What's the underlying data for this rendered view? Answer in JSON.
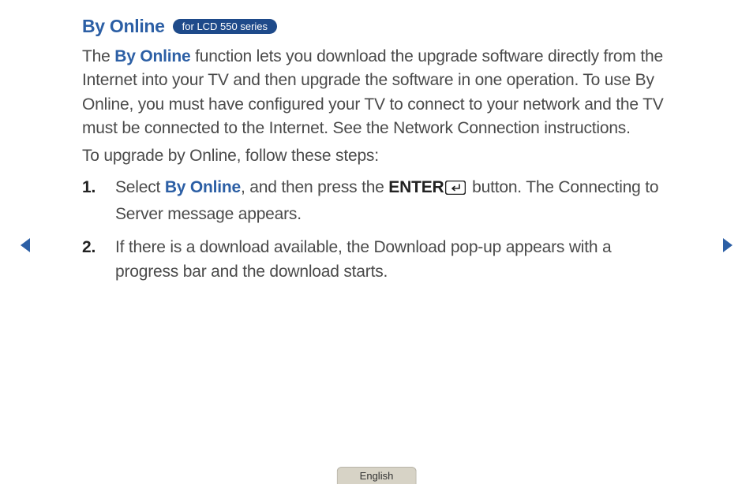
{
  "heading": {
    "title": "By Online",
    "badge": "for LCD 550 series"
  },
  "intro": {
    "part1": "The ",
    "highlight": "By Online",
    "part2": " function lets you download the upgrade software directly from the Internet into your TV and then upgrade the software in one operation. To use By Online, you must have configured your TV to connect to your network and the TV must be connected to the Internet. See the Network Connection instructions."
  },
  "followSteps": "To upgrade by Online, follow these steps:",
  "steps": [
    {
      "num": "1.",
      "pre": "Select ",
      "highlight": "By Online",
      "mid": ", and then press the ",
      "bold": "ENTER",
      "post": " button. The Connecting to Server message appears."
    },
    {
      "num": "2.",
      "text": "If there is a download available, the Download pop-up appears with a progress bar and the download starts."
    }
  ],
  "language": "English",
  "colors": {
    "accent": "#2c5fa5",
    "badgeBg": "#1e4a8a"
  }
}
